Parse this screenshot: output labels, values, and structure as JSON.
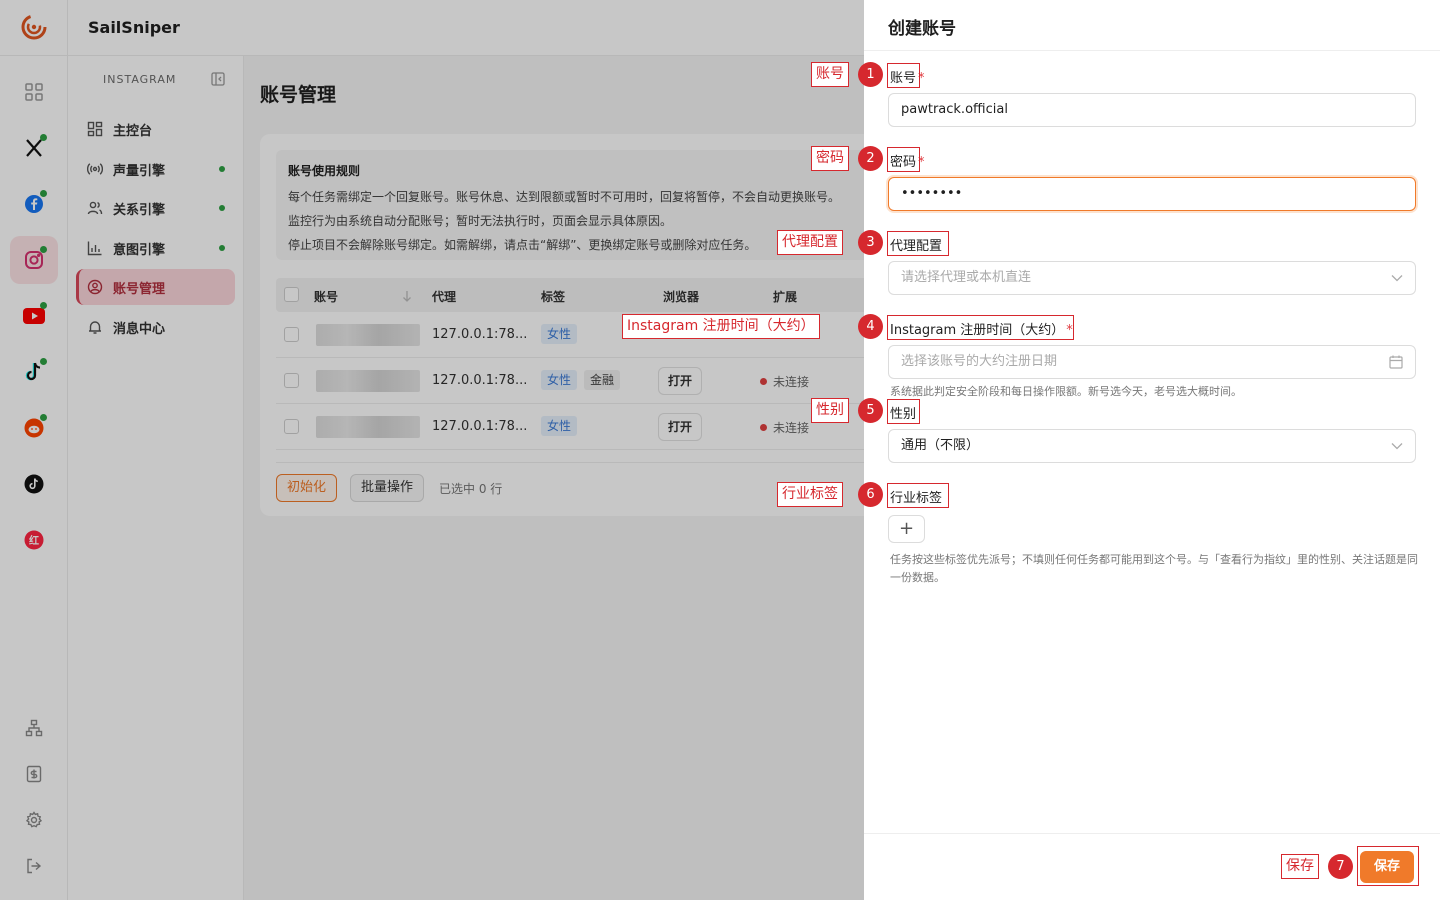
{
  "app": {
    "brand": "SailSniper"
  },
  "rail": {
    "items": [
      {
        "name": "dashboard-grid-icon"
      },
      {
        "name": "x-twitter-icon",
        "status": "online"
      },
      {
        "name": "facebook-icon",
        "status": "online"
      },
      {
        "name": "instagram-icon",
        "status": "online",
        "active": true
      },
      {
        "name": "youtube-icon",
        "status": "online"
      },
      {
        "name": "tiktok-icon",
        "status": "online"
      },
      {
        "name": "reddit-icon",
        "status": "online"
      },
      {
        "name": "tiktok-alt-icon"
      },
      {
        "name": "xiaohongshu-icon"
      }
    ],
    "bottom": [
      "org-tree-icon",
      "billing-icon",
      "settings-icon",
      "logout-icon"
    ]
  },
  "sidebar": {
    "section": "INSTAGRAM",
    "items": [
      {
        "label": "主控台",
        "icon": "dashboard-icon"
      },
      {
        "label": "声量引擎",
        "icon": "broadcast-icon",
        "status": "online"
      },
      {
        "label": "关系引擎",
        "icon": "users-icon",
        "status": "online"
      },
      {
        "label": "意图引擎",
        "icon": "bar-chart-icon",
        "status": "online"
      },
      {
        "label": "账号管理",
        "icon": "account-icon",
        "active": true
      },
      {
        "label": "消息中心",
        "icon": "bell-icon"
      }
    ]
  },
  "main": {
    "title": "账号管理",
    "rules": {
      "title": "账号使用规则",
      "lines": [
        "每个任务需绑定一个回复账号。账号休息、达到限额或暂时不可用时，回复将暂停，不会自动更换账号。",
        "监控行为由系统自动分配账号；暂时无法执行时，页面会显示具体原因。",
        "停止项目不会解除账号绑定。如需解绑，请点击“解绑”、更换绑定账号或删除对应任务。"
      ]
    },
    "table": {
      "columns": [
        "账号",
        "代理",
        "标签",
        "浏览器",
        "扩展"
      ],
      "rows": [
        {
          "proxy": "127.0.0.1:78...",
          "tags": [
            "女性"
          ],
          "browser": "",
          "status": ""
        },
        {
          "proxy": "127.0.0.1:78...",
          "tags": [
            "女性",
            "金融"
          ],
          "browser": "打开",
          "status": "未连接"
        },
        {
          "proxy": "127.0.0.1:78...",
          "tags": [
            "女性"
          ],
          "browser": "打开",
          "status": "未连接"
        }
      ]
    },
    "footer": {
      "init": "初始化",
      "batch": "批量操作",
      "selected": "已选中 0 行"
    }
  },
  "drawer": {
    "title": "创建账号",
    "fields": {
      "account": {
        "label": "账号",
        "required": "*",
        "value": "pawtrack.official"
      },
      "password": {
        "label": "密码",
        "required": "*",
        "value": "••••••••"
      },
      "proxy": {
        "label": "代理配置",
        "placeholder": "请选择代理或本机直连"
      },
      "regdate": {
        "label": "Instagram 注册时间（大约）",
        "required": "*",
        "placeholder": "选择该账号的大约注册日期",
        "hint": "系统据此判定安全阶段和每日操作限额。新号选今天，老号选大概时间。"
      },
      "gender": {
        "label": "性别",
        "value": "通用（不限）"
      },
      "industry": {
        "label": "行业标签",
        "add": "+",
        "hint": "任务按这些标签优先派号；不填则任何任务都可能用到这个号。与「查看行为指纹」里的性别、关注话题是同一份数据。"
      }
    },
    "save": "保存"
  },
  "annotations": [
    {
      "num": "1",
      "label": "账号"
    },
    {
      "num": "2",
      "label": "密码"
    },
    {
      "num": "3",
      "label": "代理配置"
    },
    {
      "num": "4",
      "label": "Instagram 注册时间（大约）"
    },
    {
      "num": "5",
      "label": "性别"
    },
    {
      "num": "6",
      "label": "行业标签"
    },
    {
      "num": "7",
      "label": "保存"
    }
  ],
  "colors": {
    "accent": "#f07a2a",
    "annotation": "#d6282e",
    "activeNav": "#fbd6db",
    "online": "#2ea043"
  }
}
